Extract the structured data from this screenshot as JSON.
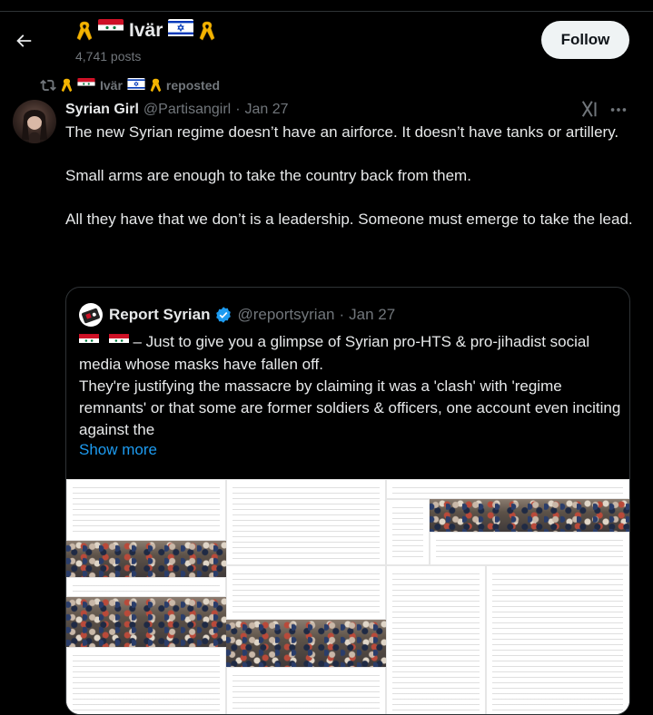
{
  "header": {
    "display_name": "Ivär",
    "posts_count": "4,741 posts",
    "follow_label": "Follow"
  },
  "repost": {
    "reposter_name": "Ivär",
    "label": "reposted"
  },
  "tweet": {
    "author_name": "Syrian Girl",
    "author_handle": "@Partisangirl",
    "separator": "·",
    "date": "Jan 27",
    "text": "The new Syrian regime doesn’t have an airforce. It doesn’t have tanks or artillery.\n\nSmall arms are enough to take the country back from them.\n\nAll they have that we don’t is a leadership. Someone must emerge to take the lead."
  },
  "quote": {
    "author_name": "Report Syrian",
    "author_handle": "@reportsyrian",
    "separator": "·",
    "date": "Jan 27",
    "text": "– Just to give you a glimpse of Syrian pro-HTS & pro-jihadist social media whose masks have fallen off.\nThey're justifying the massacre by claiming it was a 'clash' with 'regime remnants' or that some are former soldiers & officers, one account even inciting against the",
    "show_more_label": "Show more"
  },
  "icons": {
    "back": "arrow-left-icon",
    "ribbon": "yellow-ribbon-icon",
    "flag_syria": "syria-flag-icon",
    "flag_israel": "israel-flag-icon",
    "repost": "repost-icon",
    "grok": "grok-icon",
    "more": "more-options-icon",
    "verified": "verified-badge-icon"
  },
  "colors": {
    "background": "#000000",
    "text": "#e7e9ea",
    "muted": "#71767b",
    "link": "#1d9bf0",
    "follow_bg": "#eff3f4",
    "verified": "#1d9bf0",
    "border": "#2f3336"
  }
}
